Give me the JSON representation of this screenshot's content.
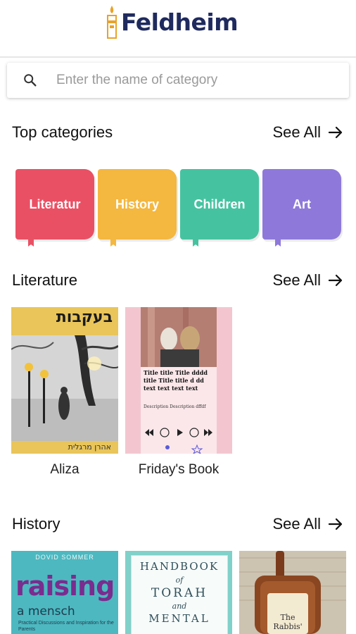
{
  "header": {
    "brand": "Feldheim"
  },
  "search": {
    "placeholder": "Enter the name of category"
  },
  "top_categories": {
    "title": "Top categories",
    "see_all": "See All",
    "items": [
      {
        "label": "Literatur",
        "color": "#ea5064"
      },
      {
        "label": "History",
        "color": "#f4b73f"
      },
      {
        "label": "Children",
        "color": "#45c3a0"
      },
      {
        "label": "Art",
        "color": "#8e79da"
      }
    ]
  },
  "literature": {
    "title": "Literature",
    "see_all": "See All",
    "books": [
      {
        "title": "Aliza",
        "cover_heading": "בעקבות",
        "cover_footer": "אהרן מרגלית"
      },
      {
        "title": "Friday's Book",
        "cover_text": "Title title Title dddd title Title title d dd text text text text",
        "cover_desc": "Description Description dffdf"
      }
    ]
  },
  "history": {
    "title": "History",
    "see_all": "See All",
    "books": [
      {
        "author": "DOVID SOMMER",
        "title_line1": "raising",
        "title_line2": "a mensch",
        "subtitle": "Practical Discussions and Inspiration for the Parents"
      },
      {
        "line1": "HANDBOOK",
        "line2": "of",
        "line3": "TORAH",
        "line4": "and",
        "line5": "MENTAL"
      },
      {
        "tag_line1": "The",
        "tag_line2": "Rabbis'"
      }
    ]
  }
}
